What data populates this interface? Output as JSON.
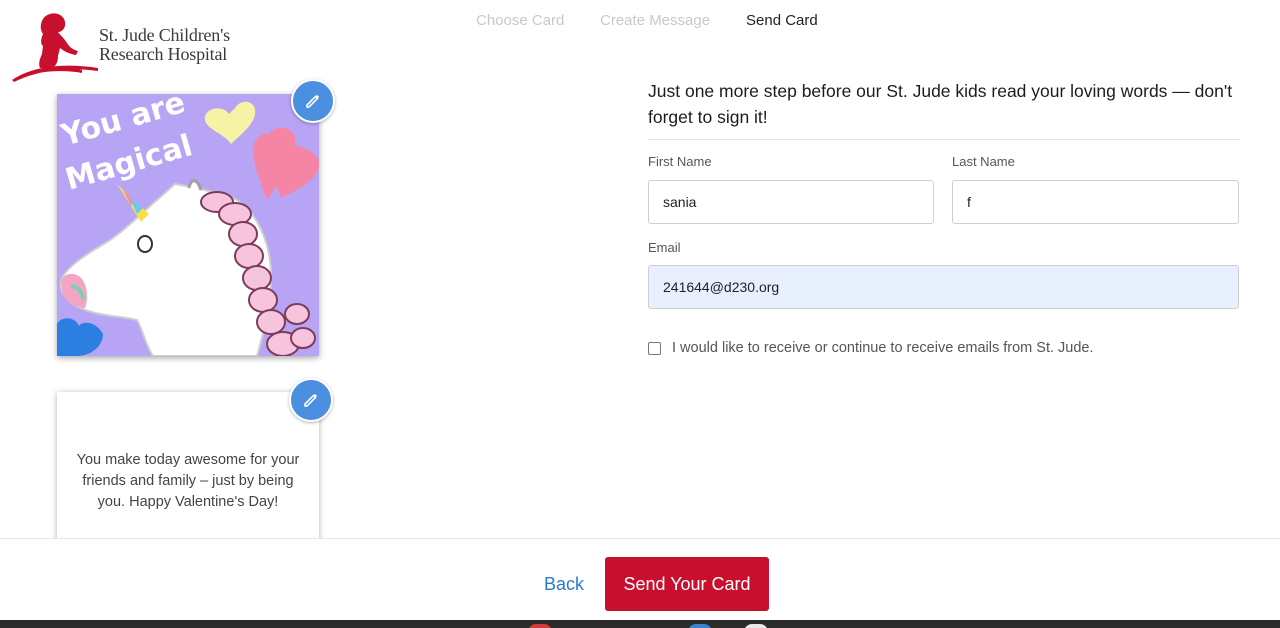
{
  "header": {
    "logo_line1": "St. Jude Children's",
    "logo_line2": "Research Hospital"
  },
  "steps": [
    {
      "label": "Choose Card",
      "state": "done"
    },
    {
      "label": "Create Message",
      "state": "done"
    },
    {
      "label": "Send Card",
      "state": "active"
    }
  ],
  "card": {
    "front_text_line1": "You are",
    "front_text_line2": "Magical",
    "message": "You make today awesome for your friends and family – just by being you. Happy Valentine's Day!"
  },
  "form": {
    "intro": "Just one more step before our St. Jude kids read your loving words — don't forget to sign it!",
    "first_name_label": "First Name",
    "first_name_value": "sania",
    "last_name_label": "Last Name",
    "last_name_value": "f",
    "email_label": "Email",
    "email_value": "241644@d230.org",
    "consent_label": "I would like to receive or continue to receive emails from St. Jude.",
    "consent_checked": false
  },
  "footer": {
    "back_label": "Back",
    "send_label": "Send Your Card"
  },
  "colors": {
    "brand_red": "#c8102e",
    "link_blue": "#2a7ad2",
    "edit_blue": "#4a8fe0",
    "card_bg": "#b7a4f5"
  },
  "icons": {
    "edit": "pencil-icon",
    "logo": "st-jude-child-statue-logo"
  }
}
